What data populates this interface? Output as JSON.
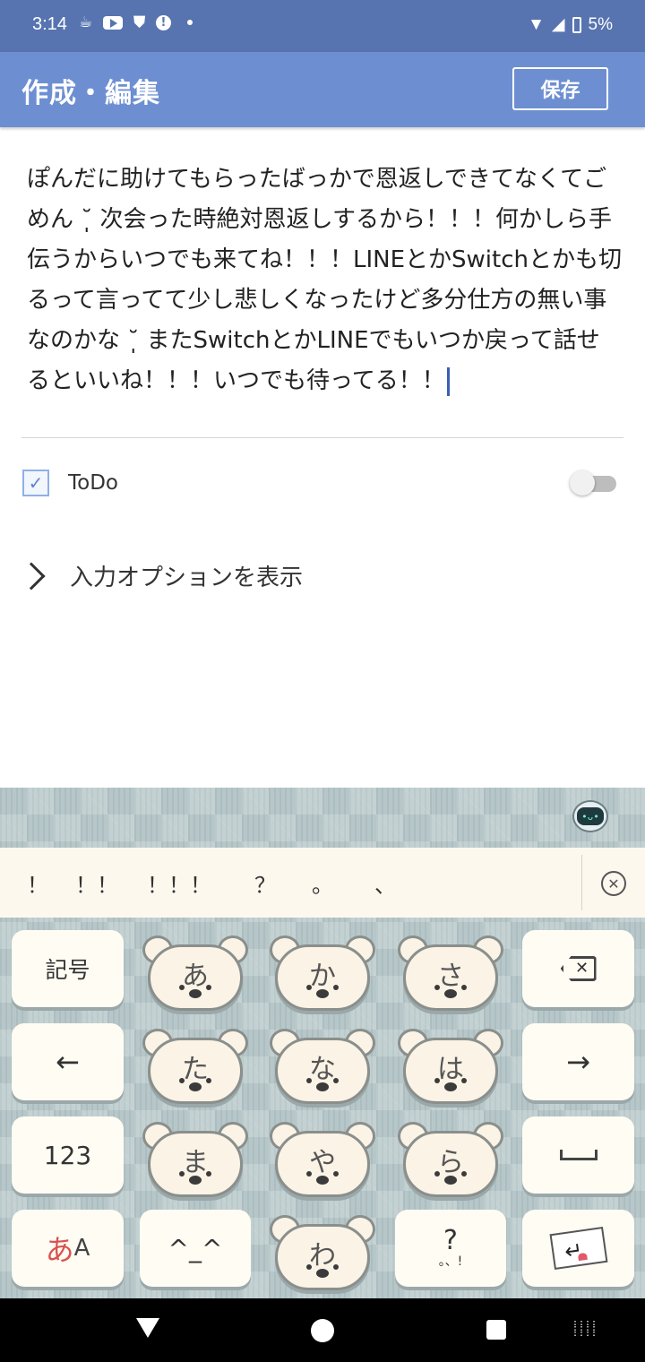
{
  "status_bar": {
    "time": "3:14",
    "notification_icons": [
      "cup-icon",
      "youtube-icon",
      "shield-alert-icon",
      "alert-icon",
      "dot-icon"
    ],
    "battery": "5%"
  },
  "app_bar": {
    "title": "作成・編集",
    "save_label": "保存"
  },
  "editor": {
    "text": "ぽんだに助けてもらったばっかで恩返しできてなくてごめん ˘̩̩̩ 次会った時絶対恩返しするから！！！何かしら手伝うからいつでも来てね！！！LINEとかSwitchとかも切るって言ってて少し悲しくなったけど多分仕方の無い事なのかな ˘̩̩̩ またSwitchとかLINEでもいつか戻って話せるといいね！！！いつでも待ってる！！"
  },
  "todo": {
    "checkbox_checked": true,
    "label": "ToDo",
    "toggle_on": false
  },
  "options": {
    "label": "入力オプションを表示"
  },
  "keyboard": {
    "suggestions": [
      "！",
      "！！",
      "！！！",
      "？",
      "。",
      "、"
    ],
    "keys": {
      "symbol": "記号",
      "a": "あ",
      "ka": "か",
      "sa": "さ",
      "left": "←",
      "ta": "た",
      "na": "な",
      "ha": "は",
      "right": "→",
      "num": "123",
      "ma": "ま",
      "ya": "や",
      "ra": "ら",
      "space": "␣",
      "mode_main": "あ",
      "mode_sub": "A",
      "emoticon": "^_^",
      "wa": "わ",
      "punct": "?",
      "punct_sub": "。、!"
    }
  }
}
